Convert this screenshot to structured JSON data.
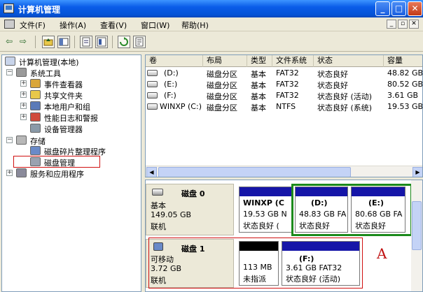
{
  "window": {
    "title": "计算机管理",
    "buttons": [
      "_",
      "□",
      "✕"
    ]
  },
  "menu": {
    "items": [
      "文件(F)",
      "操作(A)",
      "查看(V)",
      "窗口(W)",
      "帮助(H)"
    ],
    "mdi_buttons": [
      "_",
      "▫",
      "✕"
    ]
  },
  "toolbar": {
    "back": "⇦",
    "forward": "⇨"
  },
  "tree": {
    "root": "计算机管理(本地)",
    "system_tools": "系统工具",
    "event_viewer": "事件查看器",
    "shared_folders": "共享文件夹",
    "local_users": "本地用户和组",
    "perf_logs": "性能日志和警报",
    "device_manager": "设备管理器",
    "storage": "存储",
    "defrag": "磁盘碎片整理程序",
    "disk_mgmt": "磁盘管理",
    "services": "服务和应用程序"
  },
  "volumes": {
    "headers": [
      "卷",
      "布局",
      "类型",
      "文件系统",
      "状态",
      "容量"
    ],
    "rows": [
      {
        "vol": "(D:)",
        "layout": "磁盘分区",
        "type": "基本",
        "fs": "FAT32",
        "status": "状态良好",
        "cap": "48.82 GB"
      },
      {
        "vol": "(E:)",
        "layout": "磁盘分区",
        "type": "基本",
        "fs": "FAT32",
        "status": "状态良好",
        "cap": "80.52 GB"
      },
      {
        "vol": "(F:)",
        "layout": "磁盘分区",
        "type": "基本",
        "fs": "FAT32",
        "status": "状态良好 (活动)",
        "cap": "3.61 GB"
      },
      {
        "vol": "WINXP (C:)",
        "layout": "磁盘分区",
        "type": "基本",
        "fs": "NTFS",
        "status": "状态良好 (系统)",
        "cap": "19.53 GB"
      }
    ]
  },
  "disks": [
    {
      "name": "磁盘 0",
      "type": "基本",
      "size": "149.05 GB",
      "state": "联机",
      "partitions": [
        {
          "title": "WINXP (C",
          "line2": "19.53 GB N",
          "line3": "状态良好 (",
          "bar_color": "#1515a8"
        },
        {
          "title": "(D:)",
          "line2": "48.83 GB FA",
          "line3": "状态良好",
          "bar_color": "#1515a8"
        },
        {
          "title": "(E:)",
          "line2": "80.68 GB FA",
          "line3": "状态良好",
          "bar_color": "#1515a8"
        }
      ]
    },
    {
      "name": "磁盘 1",
      "type": "可移动",
      "size": "3.72 GB",
      "state": "联机",
      "partitions": [
        {
          "title": "",
          "line2": "113 MB",
          "line3": "未指派",
          "bar_color": "#000000"
        },
        {
          "title": "(F:)",
          "line2": "3.61 GB FAT32",
          "line3": "状态良好 (活动)",
          "bar_color": "#1515a8"
        }
      ]
    }
  ],
  "annotation": {
    "label": "A",
    "color": "#c01010"
  },
  "colors": {
    "title_bar": "#0553d6",
    "primary_partition": "#1515a8",
    "unallocated": "#000000",
    "highlight_green": "#1c8a1c",
    "highlight_red": "#d01010"
  }
}
